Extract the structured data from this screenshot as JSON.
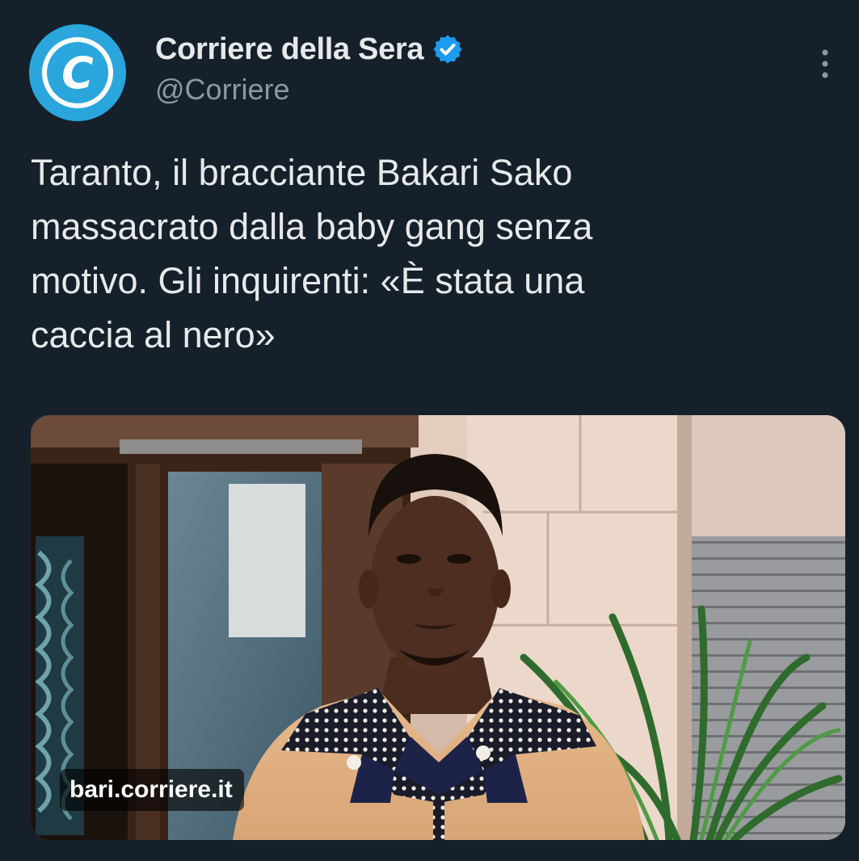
{
  "author": {
    "name": "Corriere della Sera",
    "handle": "@Corriere",
    "avatar_letter": "C",
    "avatar_color": "#2aa6dd",
    "verified": true,
    "verified_color": "#1d9bf0"
  },
  "tweet": {
    "text": "Taranto, il bracciante Bakari Sako\nmassacrato dalla baby gang senza\nmotivo. Gli inquirenti: «È stata una\ncaccia al nero»"
  },
  "card": {
    "domain": "bari.corriere.it"
  },
  "icons": {
    "more": "more-vertical-icon",
    "verified": "verified-badge-icon"
  },
  "colors": {
    "background": "#15202b",
    "text": "#e7e9ea",
    "muted": "#8b98a5"
  }
}
